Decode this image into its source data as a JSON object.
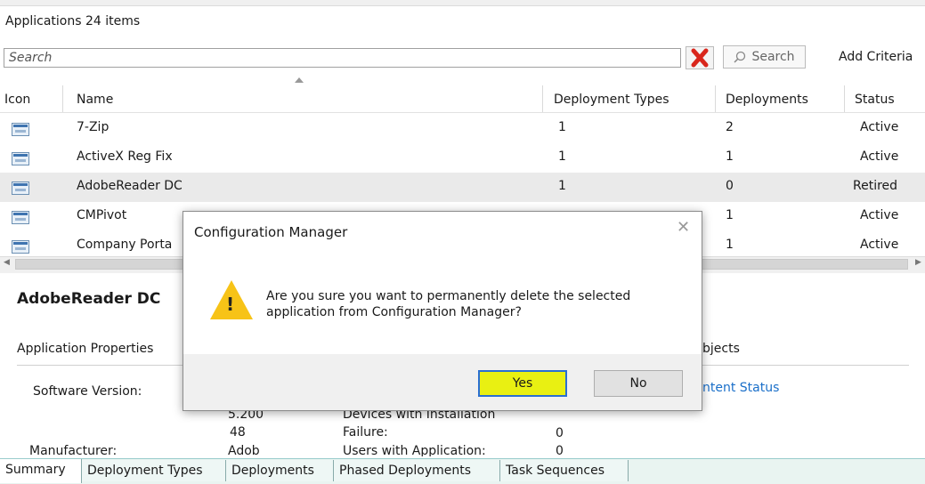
{
  "list": {
    "title": "Applications 24 items",
    "search_placeholder": "Search",
    "search_button": "Search",
    "add_criteria": "Add Criteria",
    "columns": [
      "Icon",
      "Name",
      "Deployment Types",
      "Deployments",
      "Status"
    ],
    "rows": [
      {
        "name": "7-Zip",
        "deployment_types": "1",
        "deployments": "2",
        "status": "Active"
      },
      {
        "name": "ActiveX Reg Fix",
        "deployment_types": "1",
        "deployments": "1",
        "status": "Active"
      },
      {
        "name": "AdobeReader DC",
        "deployment_types": "1",
        "deployments": "0",
        "status": "Retired"
      },
      {
        "name": "CMPivot",
        "deployment_types": "",
        "deployments": "1",
        "status": "Active"
      },
      {
        "name": "Company Porta",
        "deployment_types": "",
        "deployments": "1",
        "status": "Active"
      }
    ]
  },
  "details": {
    "title": "AdobeReader DC",
    "section_properties": "Application Properties",
    "section_related": "bjects",
    "software_version_label": "Software Version:",
    "related_link": "ntent Status",
    "version_fragment": "5.200",
    "value_48": "48",
    "devices_label": "Devices with Installation",
    "failure_label": "Failure:",
    "failure_value": "0",
    "manufacturer_label": "Manufacturer:",
    "manufacturer_value": "Adob",
    "users_label": "Users with Application:",
    "users_value": "0"
  },
  "tabs": [
    "Summary",
    "Deployment Types",
    "Deployments",
    "Phased Deployments",
    "Task Sequences"
  ],
  "dialog": {
    "title": "Configuration Manager",
    "message_line1": "Are you sure you want to permanently delete the selected",
    "message_line2": "application from Configuration Manager?",
    "yes": "Yes",
    "no": "No",
    "close": "✕"
  },
  "colors": {
    "yes_highlight": "#e9f012",
    "warning": "#f7c317",
    "link": "#1a6fc9",
    "clear_icon": "#d9261c"
  }
}
